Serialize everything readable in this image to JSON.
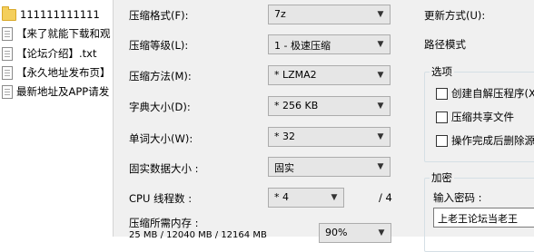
{
  "file_list": [
    {
      "name": "111111111111",
      "icon": "folder-icon"
    },
    {
      "name": "【来了就能下载和观",
      "icon": "file-icon"
    },
    {
      "name": "【论坛介绍】.txt",
      "icon": "file-icon"
    },
    {
      "name": "【永久地址发布页】",
      "icon": "file-icon"
    },
    {
      "name": "最新地址及APP请发",
      "icon": "file-icon"
    }
  ],
  "dialog": {
    "format": {
      "label": "压缩格式(F):",
      "value": "7z"
    },
    "level": {
      "label": "压缩等级(L):",
      "value": "1 - 极速压缩"
    },
    "method": {
      "label": "压缩方法(M):",
      "value": "* LZMA2"
    },
    "dict": {
      "label": "字典大小(D):",
      "value": "* 256 KB"
    },
    "word": {
      "label": "单词大小(W):",
      "value": "* 32"
    },
    "solid": {
      "label": "固实数据大小 :",
      "value": "固实"
    },
    "threads": {
      "label": "CPU 线程数 :",
      "value": "* 4",
      "total": "/ 4"
    },
    "memory": {
      "label": "压缩所需内存 :",
      "detail": "25 MB / 12040 MB / 12164 MB",
      "percent": "90%"
    },
    "update_mode": {
      "label": "更新方式(U):"
    },
    "path_mode": {
      "label": "路径模式"
    },
    "options": {
      "title": "选项",
      "sfx": "创建自解压程序(X",
      "shared": "压缩共享文件",
      "delete": "操作完成后删除源"
    },
    "encryption": {
      "title": "加密",
      "password_label": "输入密码 :",
      "password_value": "上老王论坛当老王"
    }
  }
}
